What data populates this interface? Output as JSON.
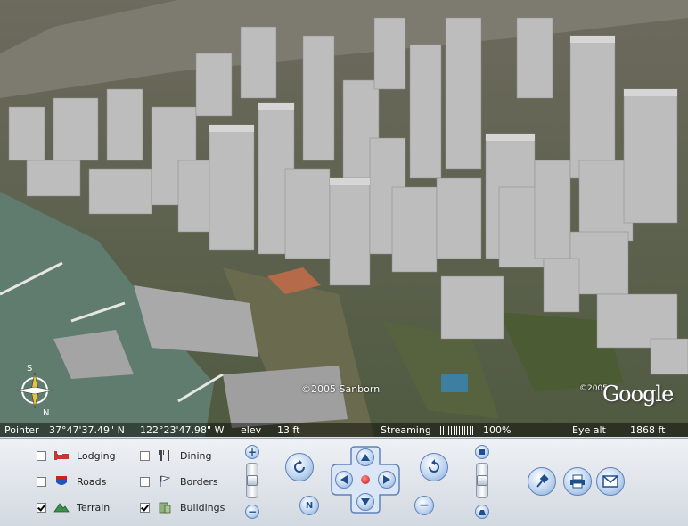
{
  "map": {
    "copyright": "©2005 Sanborn",
    "copyright_secondary": "©2005",
    "logo": "Google",
    "compass_letters": {
      "north": "N",
      "south": "S"
    }
  },
  "status": {
    "pointer_label": "Pointer",
    "pointer_lat": "37°47'37.49\" N",
    "pointer_lon": "122°23'47.98\" W",
    "elev_label": "elev",
    "elev_value": "13 ft",
    "streaming_label": "Streaming",
    "streaming_percent": "100%",
    "eye_alt_label": "Eye  alt",
    "eye_alt_value": "1868 ft"
  },
  "layers": [
    {
      "label": "Lodging",
      "checked": false,
      "icon": "bed-icon"
    },
    {
      "label": "Roads",
      "checked": false,
      "icon": "road-shield-icon"
    },
    {
      "label": "Terrain",
      "checked": true,
      "icon": "mountain-icon"
    },
    {
      "label": "Dining",
      "checked": false,
      "icon": "fork-knife-icon"
    },
    {
      "label": "Borders",
      "checked": false,
      "icon": "flag-icon"
    },
    {
      "label": "Buildings",
      "checked": true,
      "icon": "building-icon"
    }
  ],
  "navigation": {
    "north_button": "N",
    "zoom_level": 0.5,
    "tilt_level": 0.5
  },
  "colors": {
    "water": "#5f7c6f",
    "building": "#b5b5b5",
    "panel_accent": "#5f83b8"
  }
}
